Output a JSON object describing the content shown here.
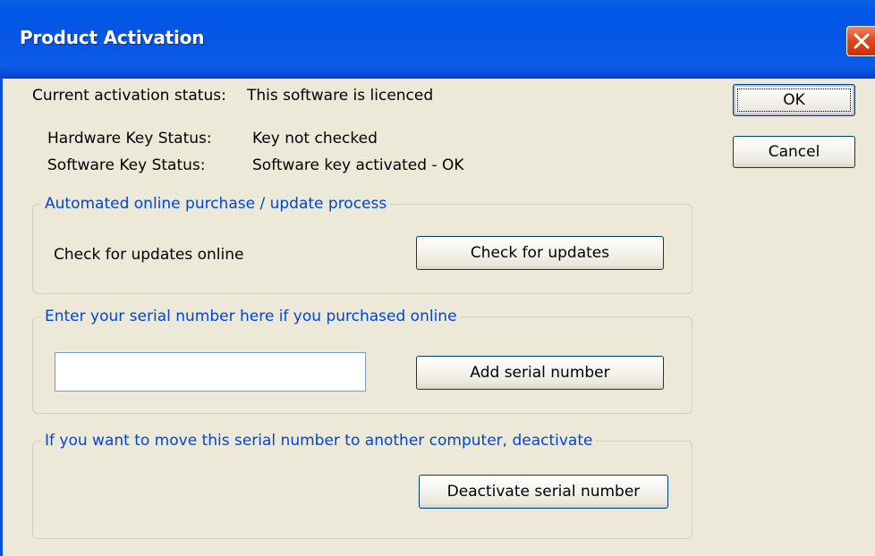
{
  "window": {
    "title": "Product Activation"
  },
  "status": {
    "current_label": "Current activation status:",
    "current_value": "This software is licenced",
    "hardware_label": "Hardware Key Status:",
    "hardware_value": "Key not checked",
    "software_label": "Software Key Status:",
    "software_value": "Software key activated - OK"
  },
  "buttons": {
    "ok": "OK",
    "cancel": "Cancel"
  },
  "updates_group": {
    "legend": "Automated online purchase / update process",
    "label": "Check for updates online",
    "button": "Check for updates"
  },
  "serial_group": {
    "legend": "Enter your serial number here if you purchased online",
    "input_value": "",
    "button": "Add serial number"
  },
  "deactivate_group": {
    "legend": "If you want to move this serial number to another computer, deactivate",
    "faded_text": "",
    "button": "Deactivate serial number"
  },
  "colors": {
    "title_bar": "#0756e5",
    "face": "#ece9d8",
    "group_legend": "#0046d5",
    "close_button": "#e0481e"
  },
  "icons": {
    "close": "close-icon"
  }
}
